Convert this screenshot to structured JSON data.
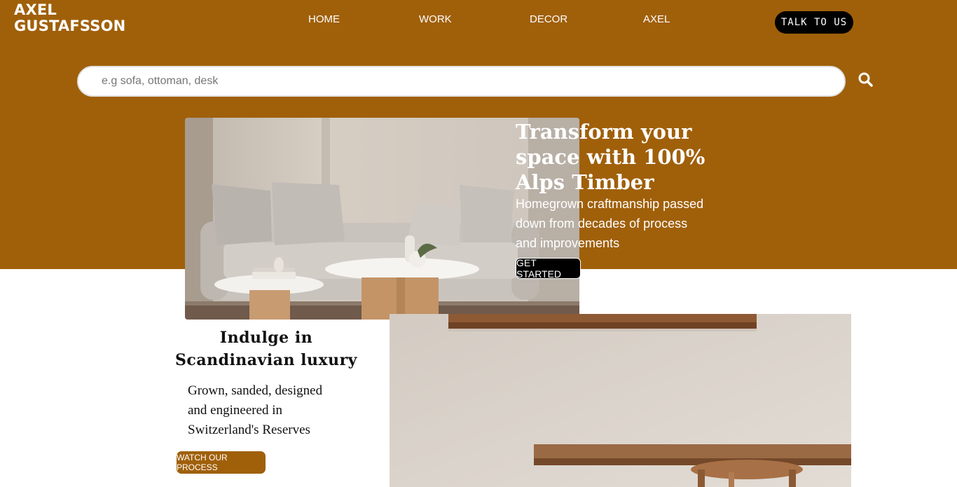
{
  "brand": {
    "line1": "AXEL",
    "line2": "GUSTAFSSON"
  },
  "nav": {
    "items": [
      {
        "label": "HOME"
      },
      {
        "label": "WORK"
      },
      {
        "label": "DECOR"
      },
      {
        "label": "AXEL"
      }
    ],
    "cta_label": "TALK TO US"
  },
  "search": {
    "placeholder": "e.g sofa, ottoman, desk",
    "icon": "search-icon"
  },
  "hero": {
    "title": "Transform your space with 100% Alps Timber",
    "subtitle": "Homegrown craftmanship passed down from decades of process and improvements",
    "button_label": "GET STARTED",
    "image": "living-room-sofa-photo"
  },
  "feature": {
    "title": "Indulge in Scandinavian luxury",
    "description": "Grown, sanded, designed and engineered in Switzerland's Reserves",
    "button_label": "WATCH OUR PROCESS",
    "image": "wooden-wall-shelves-photo"
  },
  "colors": {
    "brand": "#a0600a",
    "black": "#000000",
    "white": "#ffffff"
  }
}
